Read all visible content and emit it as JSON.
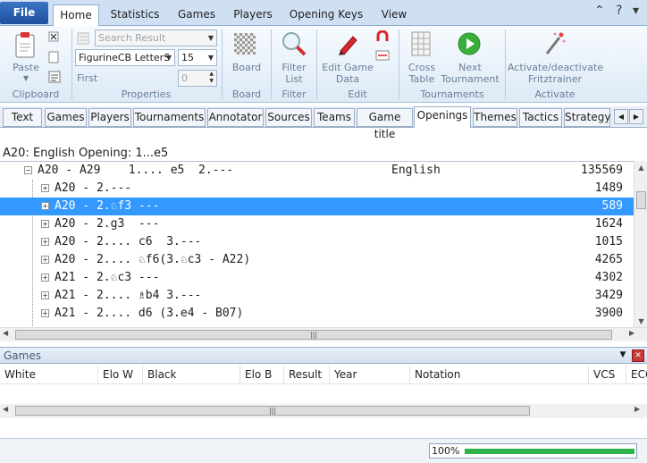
{
  "ribbon": {
    "file_label": "File",
    "tabs": [
      "Home",
      "Statistics",
      "Games",
      "Players",
      "Opening Keys",
      "View"
    ],
    "clipboard": {
      "paste_label": "Paste",
      "group_label": "Clipboard"
    },
    "properties": {
      "search_placeholder": "Search Result",
      "font_value": "FigurineCB LetterS",
      "size_value": "15",
      "first_label": "First",
      "first_value": "0",
      "group_label": "Properties"
    },
    "board": {
      "button_label": "Board",
      "group_label": "Board"
    },
    "filter": {
      "button_label": "Filter List",
      "group_label": "Filter"
    },
    "edit": {
      "button_label": "Edit Game Data",
      "group_label": "Edit"
    },
    "tournaments": {
      "cross_label": "Cross Table",
      "next_label": "Next Tournament",
      "group_label": "Tournaments"
    },
    "activate": {
      "button_label": "Activate/deactivate Fritztrainer",
      "group_label": "Activate"
    }
  },
  "db_tabs": [
    "Text",
    "Games",
    "Players",
    "Tournaments",
    "Annotator",
    "Sources",
    "Teams",
    "Game title",
    "Openings",
    "Themes",
    "Tactics",
    "Strategy"
  ],
  "db_active": "Openings",
  "opening_title": "A20: English Opening: 1...e5",
  "tree": {
    "root": {
      "text": "A20 - A29    1.... e5  2.---",
      "name": "English",
      "count": "135569"
    },
    "rows": [
      {
        "text": "A20 - 2.---",
        "count": "1489",
        "selected": false
      },
      {
        "text": "A20 - 2.♘f3 ---",
        "count": "589",
        "selected": true
      },
      {
        "text": "A20 - 2.g3  ---",
        "count": "1624",
        "selected": false
      },
      {
        "text": "A20 - 2.... c6  3.---",
        "count": "1015",
        "selected": false
      },
      {
        "text": "A20 - 2.... ♘f6(3.♘c3 - A22)",
        "count": "4265",
        "selected": false
      },
      {
        "text": "A21 - 2.♘c3 ---",
        "count": "4302",
        "selected": false
      },
      {
        "text": "A21 - 2.... ♗b4 3.---",
        "count": "3429",
        "selected": false
      },
      {
        "text": "A21 - 2.... d6 (3.e4 - B07)",
        "count": "3900",
        "selected": false
      }
    ]
  },
  "games_panel": {
    "title": "Games",
    "columns": [
      "White",
      "Elo W",
      "Black",
      "Elo B",
      "Result",
      "Year",
      "Notation",
      "VCS",
      "ECO"
    ]
  },
  "status": {
    "progress_text": "100%",
    "progress_value": 1.0
  }
}
